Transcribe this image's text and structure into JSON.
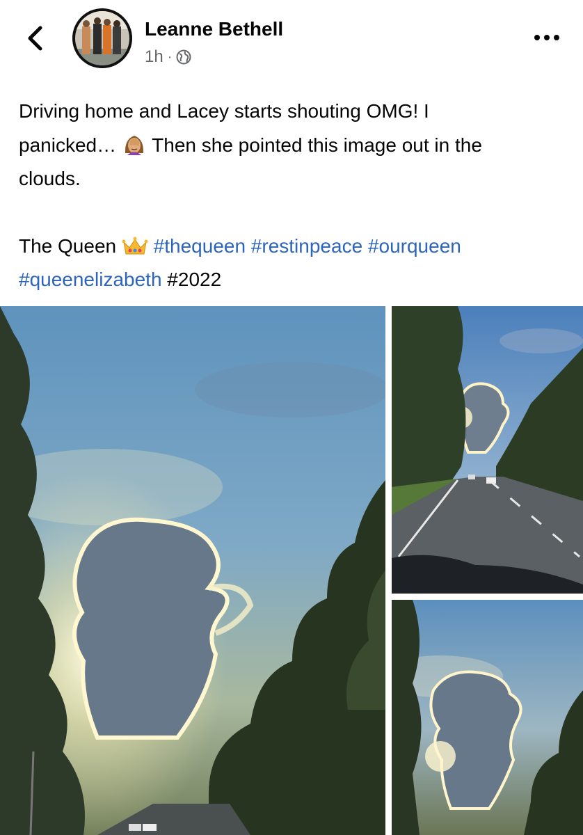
{
  "post": {
    "author": "Leanne Bethell",
    "time": "1h",
    "separator": "·",
    "audience_icon": "globe-icon",
    "text": {
      "line1": "Driving home and Lacey starts shouting OMG! I",
      "line2_a": "panicked…",
      "line2_b": "Then she pointed this image out in the",
      "line3": "clouds.",
      "caption_a": "The Queen",
      "hashtags_line1": [
        "#thequeen",
        "#restinpeace",
        "#ourqueen"
      ],
      "hashtag_line2": "#queenelizabeth",
      "plain_tag": "#2022"
    },
    "emojis": [
      "face-palm-emoji",
      "crown-emoji"
    ]
  },
  "icons": {
    "back": "chevron-left-icon",
    "more": "more-horizontal-icon"
  },
  "colors": {
    "text": "#050505",
    "secondary": "#65676b",
    "hashtag": "#2d64bc",
    "sky": "#6f9cc0"
  },
  "photos": [
    "cloud-photo-main",
    "road-photo",
    "cloud-photo-small"
  ]
}
